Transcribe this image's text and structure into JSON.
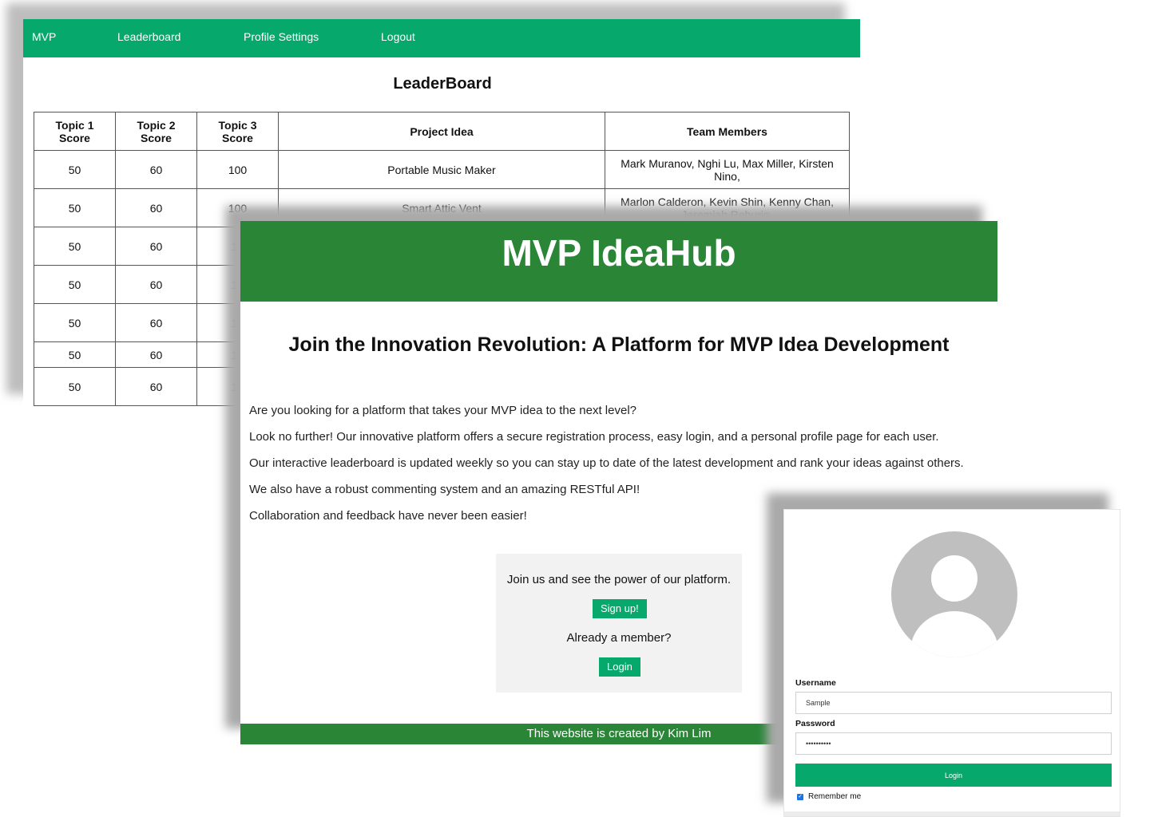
{
  "leaderboard_window": {
    "nav": {
      "brand": "MVP",
      "links": [
        "Leaderboard",
        "Profile Settings",
        "Logout"
      ]
    },
    "title": "LeaderBoard",
    "columns": [
      "Topic 1 Score",
      "Topic 2 Score",
      "Topic 3 Score",
      "Project Idea",
      "Team Members"
    ],
    "rows": [
      [
        "50",
        "60",
        "100",
        "Portable Music Maker",
        "Mark Muranov, Nghi Lu, Max Miller, Kirsten Nino,"
      ],
      [
        "50",
        "60",
        "100",
        "Smart Attic Vent",
        "Marlon Calderon, Kevin Shin, Kenny Chan, Jeremiah Reburio,"
      ],
      [
        "50",
        "60",
        "10",
        "",
        ""
      ],
      [
        "50",
        "60",
        "10",
        "",
        ""
      ],
      [
        "50",
        "60",
        "10",
        "",
        ""
      ],
      [
        "50",
        "60",
        "10",
        "",
        ""
      ],
      [
        "50",
        "60",
        "10",
        "",
        ""
      ]
    ]
  },
  "landing_window": {
    "hero_title": "MVP IdeaHub",
    "tagline": "Join the Innovation Revolution: A Platform for MVP Idea Development",
    "paragraphs": [
      "Are you looking for a platform that takes your MVP idea to the next level?",
      "Look no further! Our innovative platform offers a secure registration process, easy login, and a personal profile page for each user.",
      "Our interactive leaderboard is updated weekly so you can stay up to date of the latest development and rank your ideas against others.",
      "We also have a robust commenting system and an amazing RESTful API!",
      "Collaboration and feedback have never been easier!"
    ],
    "cta": {
      "join_text": "Join us and see the power of our platform.",
      "signup_label": "Sign up!",
      "member_text": "Already a member?",
      "login_label": "Login"
    },
    "footer": "This website is created by Kim Lim"
  },
  "login_window": {
    "avatar_icon": "user-avatar-icon",
    "username_label": "Username",
    "username_value": "Sample",
    "password_label": "Password",
    "password_value": "••••••••••",
    "login_label": "Login",
    "remember_label": "Remember me",
    "remember_checked": true
  },
  "colors": {
    "nav_green": "#06a96b",
    "hero_green": "#2a8537",
    "button_green": "#06a96b"
  }
}
